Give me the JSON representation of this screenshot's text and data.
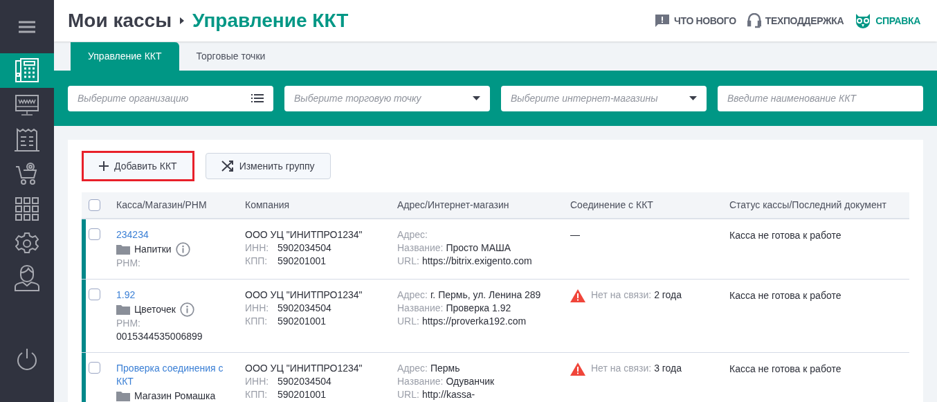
{
  "sidebar": {
    "items": [
      {
        "selected": false,
        "kind": "menu"
      },
      {
        "selected": true,
        "kind": "register"
      },
      {
        "selected": false,
        "kind": "web"
      },
      {
        "selected": false,
        "kind": "receipt"
      },
      {
        "selected": false,
        "kind": "cart"
      },
      {
        "selected": false,
        "kind": "grid"
      },
      {
        "selected": false,
        "kind": "settings"
      },
      {
        "selected": false,
        "kind": "user"
      },
      {
        "selected": false,
        "kind": "power"
      }
    ]
  },
  "header": {
    "breadcrumb": [
      "Мои кассы",
      "Управление ККТ"
    ],
    "links": [
      {
        "label": "ЧТО НОВОГО",
        "kind": "news"
      },
      {
        "label": "ТЕХПОДДЕРЖКА",
        "kind": "support"
      },
      {
        "label": "СПРАВКА",
        "kind": "help"
      }
    ]
  },
  "tabs": [
    {
      "label": "Управление ККТ",
      "selected": true
    },
    {
      "label": "Торговые точки",
      "selected": false
    }
  ],
  "filters": [
    {
      "placeholder": "Выберите организацию",
      "kind": "list"
    },
    {
      "placeholder": "Выберите торговую точку",
      "kind": "dropdown"
    },
    {
      "placeholder": "Выберите интернет-магазины",
      "kind": "dropdown"
    },
    {
      "placeholder": "Введите наименование ККТ",
      "kind": "text"
    }
  ],
  "buttons": [
    {
      "label": "Добавить ККТ",
      "kind": "add",
      "outlined": true
    },
    {
      "label": "Изменить группу",
      "kind": "shuffle",
      "outlined": false
    }
  ],
  "table": {
    "header_checked": false,
    "columns": [
      "Касса/Магазин/РНМ",
      "Компания",
      "Адрес/Интернет-магазин",
      "Соединение с ККТ",
      "Статус кассы/Последний документ"
    ],
    "rows": [
      {
        "checked": false,
        "name": "234234",
        "store": "Напитки",
        "info": true,
        "rnm_label": "РНМ:",
        "company": "ООО УЦ \"ИНИТПРО1234\"",
        "inn_label": "ИНН:",
        "inn": "5902034504",
        "kpp_label": "КПП:",
        "kpp": "590201001",
        "address": [
          {
            "label": "Адрес:"
          },
          {
            "label": "Название:",
            "value": "Просто МАША"
          },
          {
            "label": "URL:",
            "value": "https://bitrix.exigento.com"
          }
        ],
        "connection": {
          "warning": false,
          "value": "—"
        },
        "status": "Касса не готова к работе"
      },
      {
        "checked": false,
        "name": "1.92",
        "store": "Цветочек",
        "info": true,
        "rnm_label": "РНМ:",
        "rnm": "0015344535006899",
        "company": "ООО УЦ \"ИНИТПРО1234\"",
        "inn_label": "ИНН:",
        "inn": "5902034504",
        "kpp_label": "КПП:",
        "kpp": "590201001",
        "address": [
          {
            "label": "Адрес:",
            "value": "г. Пермь, ул. Ленина 289"
          },
          {
            "label": "Название:",
            "value": "Проверка 1.92"
          },
          {
            "label": "URL:",
            "value": "https://proverka192.com"
          }
        ],
        "connection": {
          "warning": true,
          "label": "Нет на связи:",
          "value": "2 года"
        },
        "status": "Касса не готова к работе"
      },
      {
        "checked": false,
        "name": "Проверка соединения с ККТ",
        "store": "Магазин Ромашка",
        "info": false,
        "company": "ООО УЦ \"ИНИТПРО1234\"",
        "inn_label": "ИНН:",
        "inn": "5902034504",
        "kpp_label": "КПП:",
        "kpp": "590201001",
        "address": [
          {
            "label": "Адрес:",
            "value": "Пермь"
          },
          {
            "label": "Название:",
            "value": "Одуванчик"
          },
          {
            "label": "URL:",
            "value": "http://kassa-"
          }
        ],
        "connection": {
          "warning": true,
          "label": "Нет на связи:",
          "value": "3 года"
        },
        "status": "Касса не готова к работе"
      }
    ]
  }
}
